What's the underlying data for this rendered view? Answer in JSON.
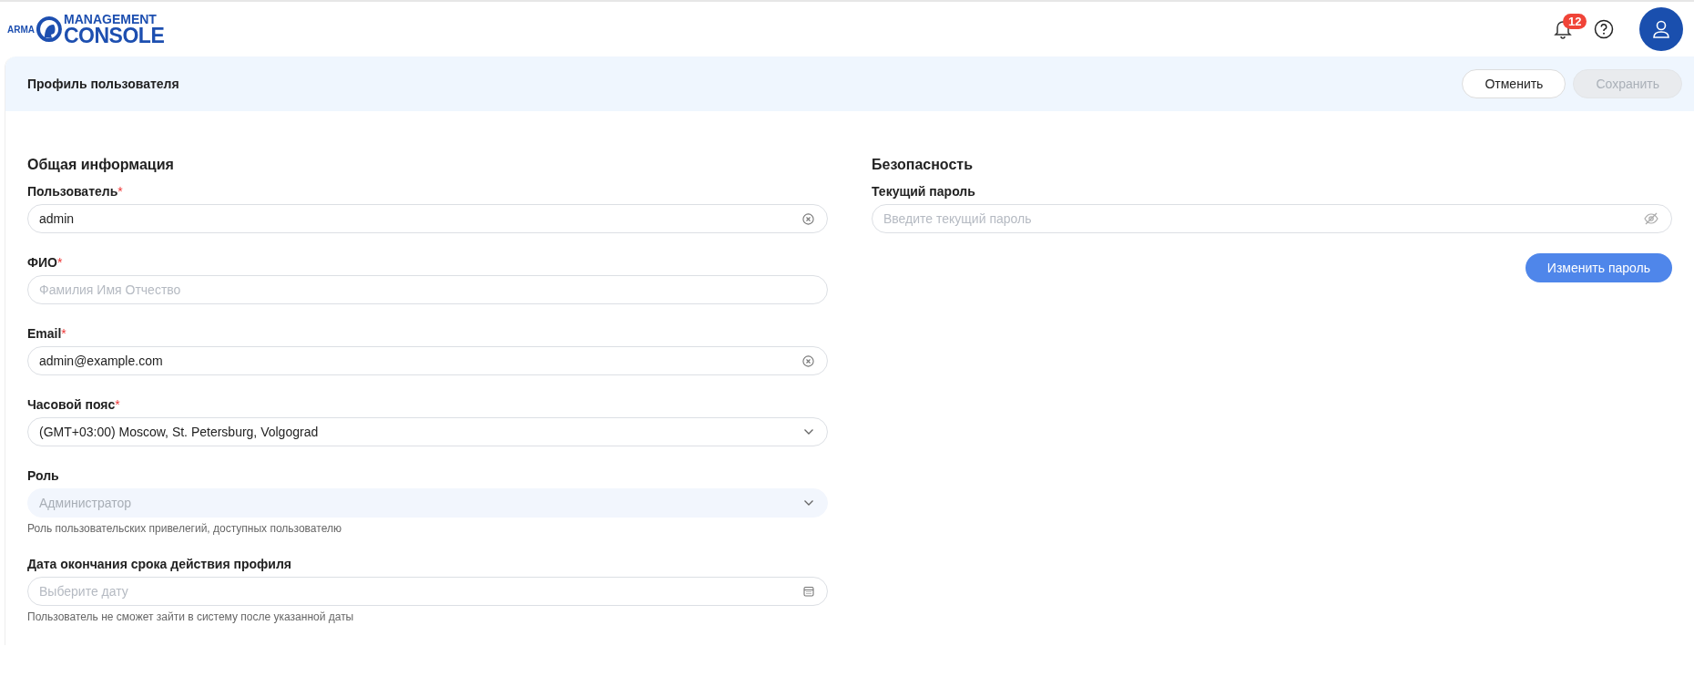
{
  "header": {
    "logo": {
      "prefix": "ARMA",
      "top": "MANAGEMENT",
      "bottom": "CONSOLE"
    },
    "notifications": {
      "count": "12"
    }
  },
  "page": {
    "title": "Профиль пользователя",
    "buttons": [
      {
        "label": "Отменить",
        "disabled": false
      },
      {
        "label": "Сохранить",
        "disabled": true
      }
    ]
  },
  "sections": [
    {
      "title": "Общая информация",
      "fields": [
        {
          "label": "Пользователь",
          "required_mark": "*",
          "kind": "text",
          "value": "admin",
          "clearable": true,
          "disabled": false
        },
        {
          "label": "ФИО",
          "required_mark": "*",
          "kind": "text",
          "placeholder": "Фамилия Имя Отчество",
          "clearable": false,
          "disabled": false
        },
        {
          "label": "Email",
          "required_mark": "*",
          "kind": "text",
          "value": "admin@example.com",
          "clearable": true,
          "disabled": false
        },
        {
          "label": "Часовой пояс",
          "required_mark": "*",
          "kind": "select",
          "value": "(GMT+03:00) Moscow, St. Petersburg, Volgograd",
          "disabled": false
        },
        {
          "label": "Роль",
          "kind": "select",
          "value": "Администратор",
          "disabled": true,
          "hint": "Роль пользовательских привелегий, доступных пользователю"
        },
        {
          "label": "Дата окончания срока действия профиля",
          "kind": "date",
          "placeholder": "Выберите дату",
          "disabled": false,
          "hint": "Пользователь не сможет зайти в систему после указанной даты"
        }
      ]
    },
    {
      "title": "Безопасность",
      "fields": [
        {
          "label": "Текущий пароль",
          "kind": "password",
          "placeholder": "Введите текущий пароль",
          "disabled": false
        }
      ],
      "action": {
        "label": "Изменить пароль"
      }
    }
  ]
}
